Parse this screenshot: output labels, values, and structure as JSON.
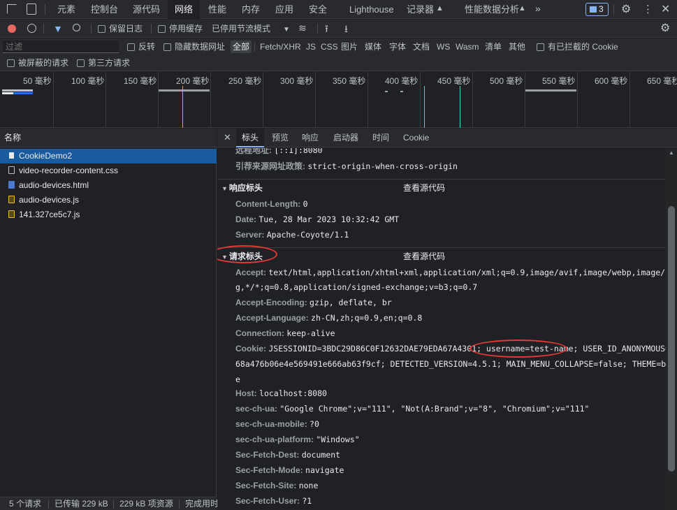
{
  "topbar": {
    "tabs": [
      "元素",
      "控制台",
      "源代码",
      "网络",
      "性能",
      "内存",
      "应用",
      "安全",
      "Lighthouse",
      "记录器",
      "性能数据分析"
    ],
    "issues_count": "3"
  },
  "toolbar": {
    "preserve_log": "保留日志",
    "disable_cache": "停用缓存",
    "throttle": "已停用节流模式"
  },
  "filter": {
    "placeholder": "过滤",
    "invert": "反转",
    "hide_data_urls": "隐藏数据网址",
    "types": [
      "全部",
      "Fetch/XHR",
      "JS",
      "CSS",
      "图片",
      "媒体",
      "字体",
      "文档",
      "WS",
      "Wasm",
      "清单",
      "其他"
    ],
    "blocked_cookies": "有已拦截的 Cookie",
    "blocked_requests": "被屏蔽的请求",
    "third_party": "第三方请求"
  },
  "timeline": {
    "ticks": [
      "50 毫秒",
      "100 毫秒",
      "150 毫秒",
      "200 毫秒",
      "250 毫秒",
      "300 毫秒",
      "350 毫秒",
      "400 毫秒",
      "450 毫秒",
      "500 毫秒",
      "550 毫秒",
      "600 毫秒",
      "650 毫秒"
    ]
  },
  "requests": {
    "header": "名称",
    "items": [
      {
        "name": "CookieDemo2",
        "type": "doc"
      },
      {
        "name": "video-recorder-content.css",
        "type": "css"
      },
      {
        "name": "audio-devices.html",
        "type": "doc"
      },
      {
        "name": "audio-devices.js",
        "type": "js"
      },
      {
        "name": "141.327ce5c7.js",
        "type": "js"
      }
    ]
  },
  "status": {
    "count": "5 个请求",
    "transferred": "已传输 229 kB",
    "resources": "229 kB 项资源",
    "finish": "完成用时"
  },
  "detail": {
    "tabs": [
      "标头",
      "预览",
      "响应",
      "启动器",
      "时间",
      "Cookie"
    ],
    "general": [
      {
        "name": "远程地址:",
        "value": "[::1]:8080"
      },
      {
        "name": "引荐来源网址政策:",
        "value": "strict-origin-when-cross-origin"
      }
    ],
    "response_section": "响应标头",
    "view_source": "查看源代码",
    "response_headers": [
      {
        "name": "Content-Length:",
        "value": "0"
      },
      {
        "name": "Date:",
        "value": "Tue, 28 Mar 2023 10:32:42 GMT"
      },
      {
        "name": "Server:",
        "value": "Apache-Coyote/1.1"
      }
    ],
    "request_section": "请求标头",
    "accept_name": "Accept:",
    "accept_l1": "text/html,application/xhtml+xml,application/xml;q=0.9,image/avif,image/webp,image/apn",
    "accept_l2": "g,*/*;q=0.8,application/signed-exchange;v=b3;q=0.7",
    "encoding_name": "Accept-Encoding:",
    "encoding_value": "gzip, deflate, br",
    "language_name": "Accept-Language:",
    "language_value": "zh-CN,zh;q=0.9,en;q=0.8",
    "connection_name": "Connection:",
    "connection_value": "keep-alive",
    "cookie_name": "Cookie:",
    "cookie_l1": "JSESSIONID=3BDC29D86C0F12632DAE79EDA67A4301; username=test-name; USER_ID_ANONYMOUS=b7",
    "cookie_l2": "68a476b06e4e569491e666ab63f9cf; DETECTED_VERSION=4.5.1; MAIN_MENU_COLLAPSE=false; THEME=blu",
    "cookie_l3": "e",
    "rest_headers": [
      {
        "name": "Host:",
        "value": "localhost:8080"
      },
      {
        "name": "sec-ch-ua:",
        "value": "\"Google Chrome\";v=\"111\", \"Not(A:Brand\";v=\"8\", \"Chromium\";v=\"111\""
      },
      {
        "name": "sec-ch-ua-mobile:",
        "value": "?0"
      },
      {
        "name": "sec-ch-ua-platform:",
        "value": "\"Windows\""
      },
      {
        "name": "Sec-Fetch-Dest:",
        "value": "document"
      },
      {
        "name": "Sec-Fetch-Mode:",
        "value": "navigate"
      },
      {
        "name": "Sec-Fetch-Site:",
        "value": "none"
      },
      {
        "name": "Sec-Fetch-User:",
        "value": "?1"
      }
    ]
  }
}
